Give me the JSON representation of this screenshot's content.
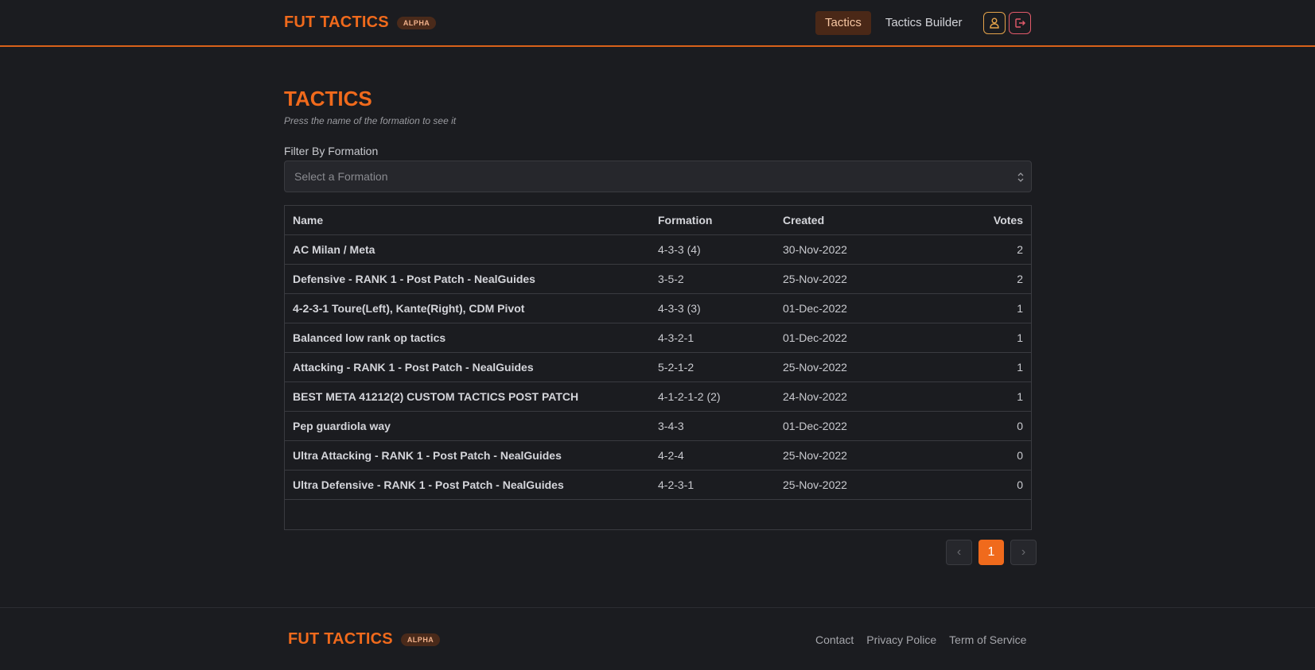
{
  "header": {
    "brand": "FUT TACTICS",
    "badge": "ALPHA",
    "nav": [
      {
        "label": "Tactics",
        "active": true
      },
      {
        "label": "Tactics Builder",
        "active": false
      }
    ],
    "icons": [
      "user-icon",
      "logout-icon"
    ]
  },
  "page": {
    "title": "TACTICS",
    "subtitle": "Press the name of the formation to see it",
    "filter_label": "Filter By Formation",
    "filter_placeholder": "Select a Formation"
  },
  "table": {
    "columns": [
      "Name",
      "Formation",
      "Created",
      "Votes"
    ],
    "rows": [
      {
        "name": "AC Milan / Meta",
        "formation": "4-3-3 (4)",
        "created": "30-Nov-2022",
        "votes": "2"
      },
      {
        "name": "Defensive - RANK 1 - Post Patch - NealGuides",
        "formation": "3-5-2",
        "created": "25-Nov-2022",
        "votes": "2"
      },
      {
        "name": "4-2-3-1 Toure(Left), Kante(Right), CDM Pivot",
        "formation": "4-3-3 (3)",
        "created": "01-Dec-2022",
        "votes": "1"
      },
      {
        "name": "Balanced low rank op tactics",
        "formation": "4-3-2-1",
        "created": "01-Dec-2022",
        "votes": "1"
      },
      {
        "name": "Attacking - RANK 1 - Post Patch - NealGuides",
        "formation": "5-2-1-2",
        "created": "25-Nov-2022",
        "votes": "1"
      },
      {
        "name": "BEST META 41212(2) CUSTOM TACTICS POST PATCH",
        "formation": "4-1-2-1-2 (2)",
        "created": "24-Nov-2022",
        "votes": "1"
      },
      {
        "name": "Pep guardiola way",
        "formation": "3-4-3",
        "created": "01-Dec-2022",
        "votes": "0"
      },
      {
        "name": "Ultra Attacking - RANK 1 - Post Patch - NealGuides",
        "formation": "4-2-4",
        "created": "25-Nov-2022",
        "votes": "0"
      },
      {
        "name": "Ultra Defensive - RANK 1 - Post Patch - NealGuides",
        "formation": "4-2-3-1",
        "created": "25-Nov-2022",
        "votes": "0"
      }
    ]
  },
  "pagination": {
    "prev": "‹",
    "current": "1",
    "next": "›"
  },
  "footer": {
    "brand": "FUT TACTICS",
    "badge": "ALPHA",
    "links": [
      "Contact",
      "Privacy Police",
      "Term of Service"
    ]
  },
  "colors": {
    "accent": "#f06a1c",
    "background": "#1b1c20"
  }
}
